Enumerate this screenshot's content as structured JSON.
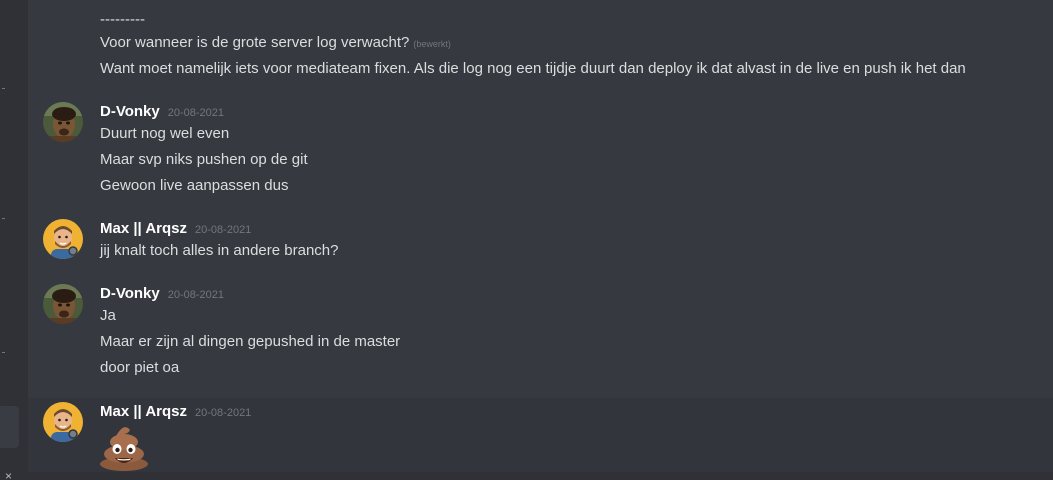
{
  "messages": {
    "group1": {
      "separator": "---------",
      "line1": "Voor wanneer is de grote server log verwacht?",
      "line1_edited": "(bewerkt)",
      "line2": "Want moet namelijk iets voor mediateam fixen. Als die log nog een tijdje duurt dan deploy ik dat alvast in de live en push ik het dan"
    },
    "group2": {
      "username": "D-Vonky",
      "timestamp": "20-08-2021",
      "lines": [
        "Duurt nog wel even",
        "Maar svp niks pushen op de git",
        "Gewoon live aanpassen dus"
      ]
    },
    "group3": {
      "username": "Max || Arqsz",
      "timestamp": "20-08-2021",
      "lines": [
        "jij knalt toch alles in andere branch?"
      ]
    },
    "group4": {
      "username": "D-Vonky",
      "timestamp": "20-08-2021",
      "lines": [
        "Ja",
        "Maar er zijn al dingen gepushed in de master",
        "door piet oa"
      ]
    },
    "group5": {
      "username": "Max || Arqsz",
      "timestamp": "20-08-2021",
      "emoji": "pile-of-poo"
    }
  },
  "sidebar": {
    "close_glyph": "×"
  },
  "colors": {
    "background": "#36393f",
    "sidebar": "#2f3136",
    "text": "#dcddde",
    "username": "#ffffff",
    "timestamp": "#72767d",
    "avatar_max_bg": "#f0b232"
  }
}
